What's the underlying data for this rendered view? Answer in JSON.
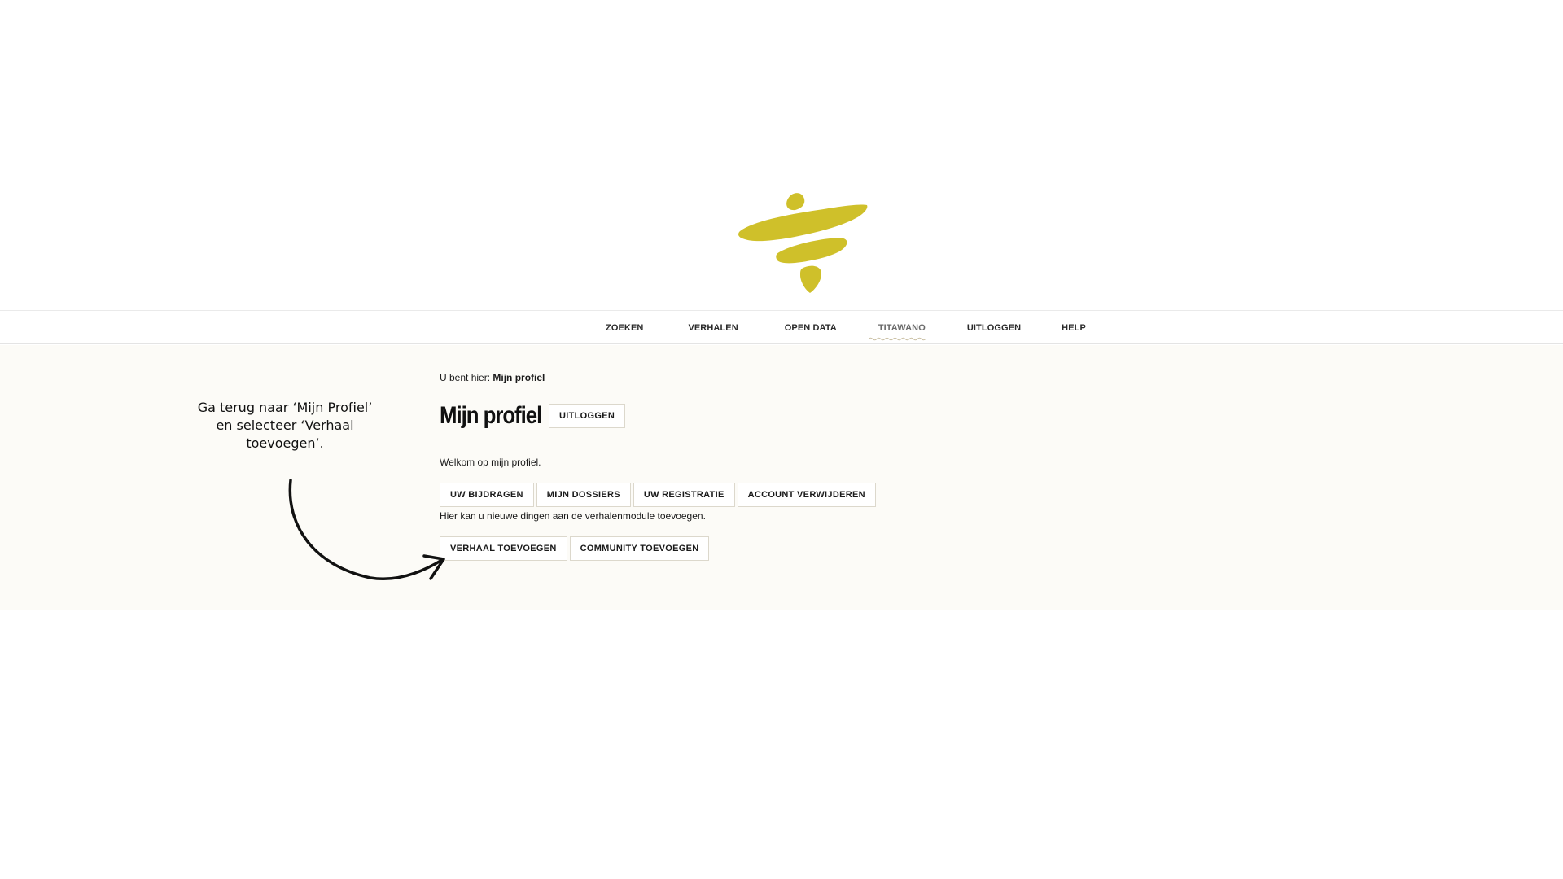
{
  "logo": {
    "icon": "brush-stroke-logo",
    "color": "#cfc02a"
  },
  "nav": {
    "items": [
      {
        "label": "ZOEKEN"
      },
      {
        "label": "VERHALEN"
      },
      {
        "label": "OPEN DATA"
      },
      {
        "label": "TITAWANO",
        "active": true
      },
      {
        "label": "UITLOGGEN"
      },
      {
        "label": "HELP"
      }
    ]
  },
  "breadcrumb": {
    "prefix": "U bent hier:",
    "current": "Mijn profiel"
  },
  "profile": {
    "title": "Mijn profiel",
    "logout_label": "UITLOGGEN",
    "welcome": "Welkom op mijn profiel.",
    "tabs": [
      {
        "label": "UW BIJDRAGEN"
      },
      {
        "label": "MIJN DOSSIERS"
      },
      {
        "label": "UW REGISTRATIE"
      },
      {
        "label": "ACCOUNT VERWIJDEREN"
      }
    ],
    "hint": "Hier kan u nieuwe dingen aan de verhalenmodule toevoegen.",
    "actions": [
      {
        "label": "VERHAAL TOEVOEGEN"
      },
      {
        "label": "COMMUNITY TOEVOEGEN"
      }
    ]
  },
  "annotation": {
    "line1": "Ga terug naar ‘Mijn Profiel’",
    "line2": "en selecteer ‘Verhaal",
    "line3": "toevoegen’."
  },
  "colors": {
    "accent": "#cfc02a",
    "content_bg": "#fcfbf7",
    "button_border": "#dcd8cc"
  }
}
